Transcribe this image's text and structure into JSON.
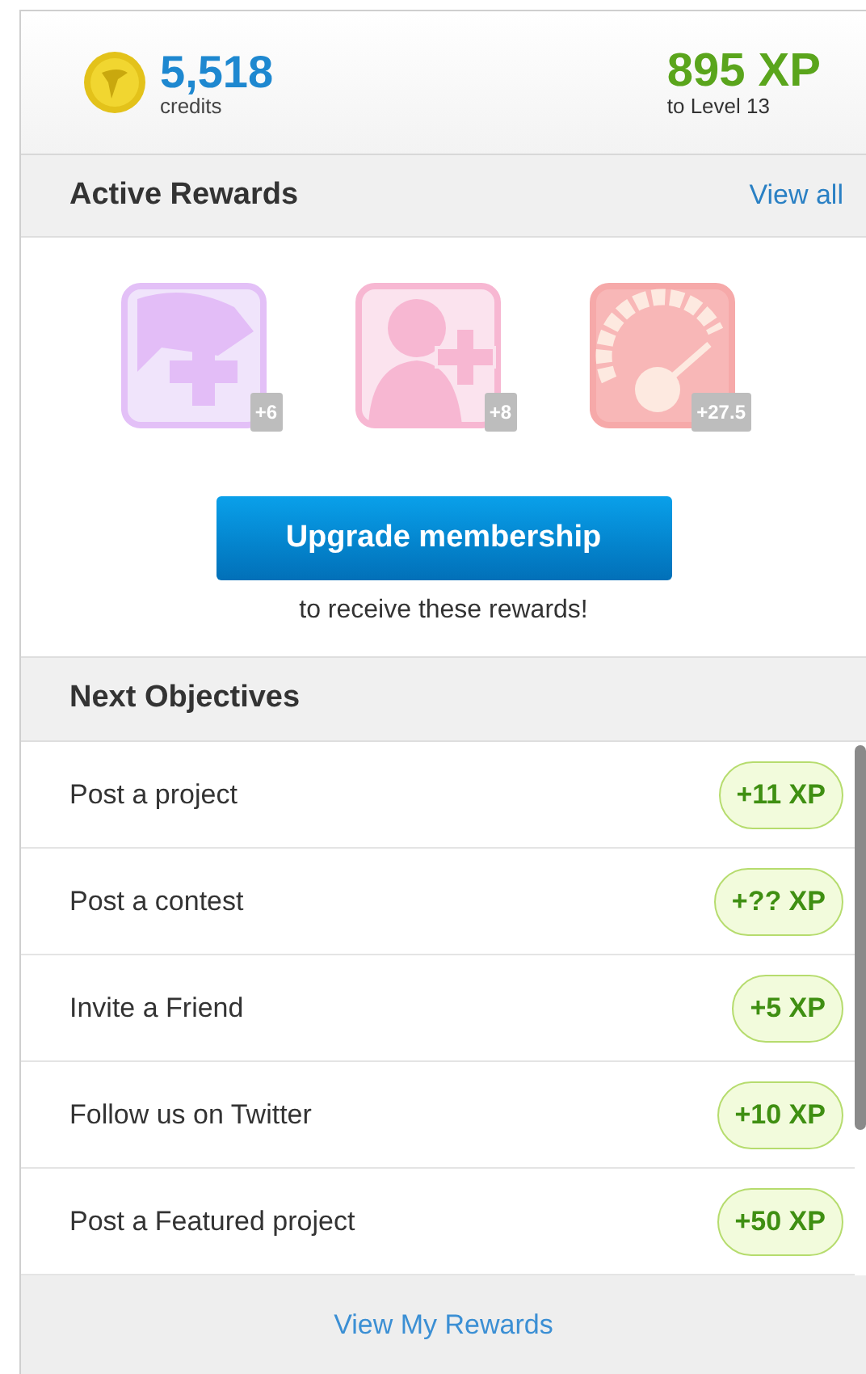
{
  "summary": {
    "credits": "5,518",
    "credits_label": "credits",
    "xp": "895 XP",
    "xp_label": "to Level 13"
  },
  "active_rewards": {
    "title": "Active Rewards",
    "link": "View all",
    "rewards": [
      {
        "kind": "cross",
        "badge": "+6"
      },
      {
        "kind": "person",
        "badge": "+8"
      },
      {
        "kind": "gauge",
        "badge": "+27.5"
      }
    ],
    "button": "Upgrade membership",
    "note": "to receive these rewards!"
  },
  "objectives": {
    "title": "Next Objectives",
    "items": [
      {
        "label": "Post a project",
        "xp": "+11 XP"
      },
      {
        "label": "Post a contest",
        "xp": "+?? XP"
      },
      {
        "label": "Invite a Friend",
        "xp": "+5 XP"
      },
      {
        "label": "Follow us on Twitter",
        "xp": "+10 XP"
      },
      {
        "label": "Post a Featured project",
        "xp": "+50 XP"
      }
    ]
  },
  "footer_link": "View My Rewards"
}
